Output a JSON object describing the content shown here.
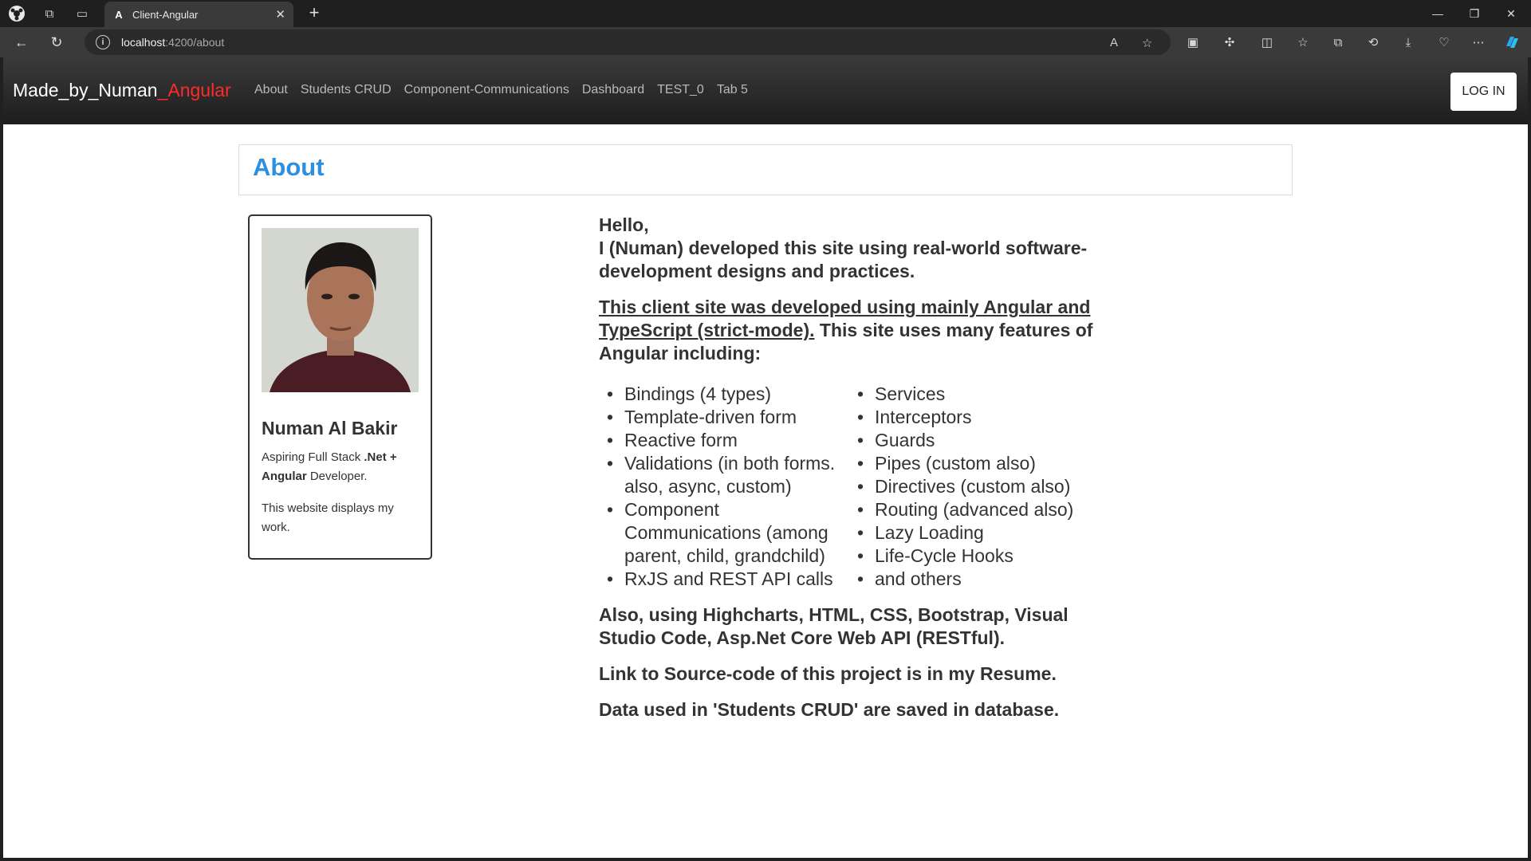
{
  "browser": {
    "tab_title": "Client-Angular",
    "tab_favicon": "A",
    "url_host": "localhost",
    "url_path": ":4200/about"
  },
  "navbar": {
    "brand_main": "Made_by_Numan",
    "brand_accent": "_Angular",
    "links": [
      "About",
      "Students CRUD",
      "Component-Communications",
      "Dashboard",
      "TEST_0",
      "Tab 5"
    ],
    "login_label": "LOG IN"
  },
  "page": {
    "heading": "About"
  },
  "card": {
    "name": "Numan Al Bakir",
    "tagline_pre": "Aspiring Full Stack ",
    "tagline_bold": ".Net + Angular",
    "tagline_post": " Developer.",
    "note": "This website displays my work."
  },
  "content": {
    "hello": "Hello,",
    "intro": "I (Numan) developed this site using real-world software-development designs and practices.",
    "underlined": "This client site was developed using mainly Angular and TypeScript (strict-mode).",
    "features_intro": " This site uses many features of Angular including:",
    "features_col1": [
      "Bindings (4 types)",
      "Template-driven form",
      "Reactive form",
      "Validations (in both forms. also, async, custom)",
      "Component Communications (among parent, child, grandchild)",
      "RxJS and REST API calls"
    ],
    "features_col2": [
      "Services",
      "Interceptors",
      "Guards",
      "Pipes (custom also)",
      "Directives (custom also)",
      "Routing (advanced also)",
      "Lazy Loading",
      "Life-Cycle Hooks",
      "and others"
    ],
    "also": "Also, using Highcharts, HTML, CSS, Bootstrap, Visual Studio Code, Asp.Net Core Web API (RESTful).",
    "link_note": "Link to Source-code of this project is in my Resume.",
    "data_note": "Data used in 'Students CRUD' are saved in database."
  },
  "colors": {
    "brand_accent": "#ff2a2a",
    "heading": "#2c8fe0",
    "navbar_bg": "#222222"
  },
  "icons": [
    "profile-icon",
    "workspaces-icon",
    "tab-actions-icon",
    "close-icon",
    "new-tab-icon",
    "minimize-icon",
    "restore-icon",
    "window-close-icon",
    "back-icon",
    "refresh-icon",
    "site-info-icon",
    "read-aloud-icon",
    "favorite-star-icon",
    "extensions-icon",
    "split-screen-icon",
    "favorites-icon",
    "collections-icon",
    "history-icon",
    "downloads-icon",
    "browser-essentials-icon",
    "more-icon",
    "copilot-icon"
  ]
}
